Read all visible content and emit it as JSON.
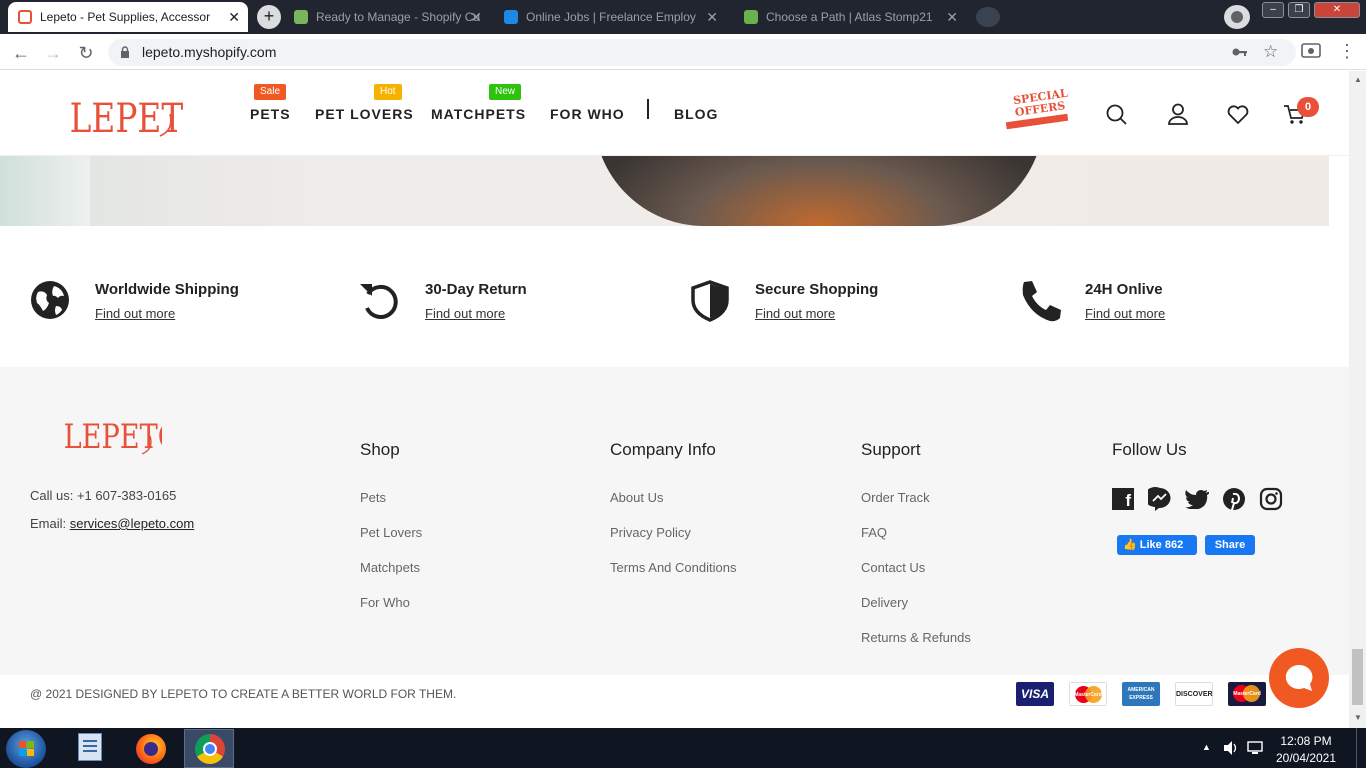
{
  "browser": {
    "tabs": [
      {
        "title": "Lepeto - Pet Supplies, Accessories",
        "favicon_color": "#e8503a"
      },
      {
        "title": "Ready to Manage - Shopify Cu",
        "favicon_color": "#7ab55c"
      },
      {
        "title": "Online Jobs | Freelance Employ",
        "favicon_color": "#1e88e5"
      },
      {
        "title": "Choose a Path | Atlas Stomp21",
        "favicon_color": "#6ab04c"
      }
    ],
    "new_tab": "+",
    "url": "lepeto.myshopify.com"
  },
  "header": {
    "logo": "LEPETO",
    "nav": [
      {
        "label": "PETS",
        "badge": "Sale",
        "badge_color": "#f05a22"
      },
      {
        "label": "PET LOVERS",
        "badge": "Hot",
        "badge_color": "#f5b300"
      },
      {
        "label": "MATCHPETS",
        "badge": "New",
        "badge_color": "#2ec20c"
      },
      {
        "label": "FOR WHO"
      },
      {
        "label": "BLOG"
      }
    ],
    "special_offers": "SPECIAL OFFERS",
    "cart_count": "0"
  },
  "features": [
    {
      "title": "Worldwide Shipping",
      "link": "Find out more",
      "icon": "globe-icon"
    },
    {
      "title": "30-Day Return",
      "link": "Find out more",
      "icon": "return-icon"
    },
    {
      "title": "Secure Shopping",
      "link": "Find out more",
      "icon": "shield-icon"
    },
    {
      "title": "24H Onlive",
      "link": "Find out more",
      "icon": "phone-icon"
    }
  ],
  "footer": {
    "logo": "LEPETO",
    "call_label": "Call us: +1 607-383-0165",
    "email_label": "Email: ",
    "email": "services@lepeto.com",
    "columns": [
      {
        "title": "Shop",
        "links": [
          "Pets",
          "Pet Lovers",
          "Matchpets",
          "For Who"
        ]
      },
      {
        "title": "Company Info",
        "links": [
          "About Us",
          "Privacy Policy",
          "Terms And Conditions"
        ]
      },
      {
        "title": "Support",
        "links": [
          "Order Track",
          "FAQ",
          "Contact Us",
          "Delivery",
          "Returns & Refunds"
        ]
      }
    ],
    "follow_title": "Follow Us",
    "fb_like": "Like 862",
    "fb_share": "Share",
    "copyright": "@ 2021 DESIGNED BY LEPETO TO CREATE A BETTER WORLD FOR THEM.",
    "payments": [
      "VISA",
      "MasterCard",
      "AMERICAN EXPRESS",
      "DISCOVER",
      "MasterCard"
    ]
  },
  "taskbar": {
    "time": "12:08 PM",
    "date": "20/04/2021"
  },
  "colors": {
    "brand": "#e8503a",
    "facebook": "#1877f2"
  }
}
